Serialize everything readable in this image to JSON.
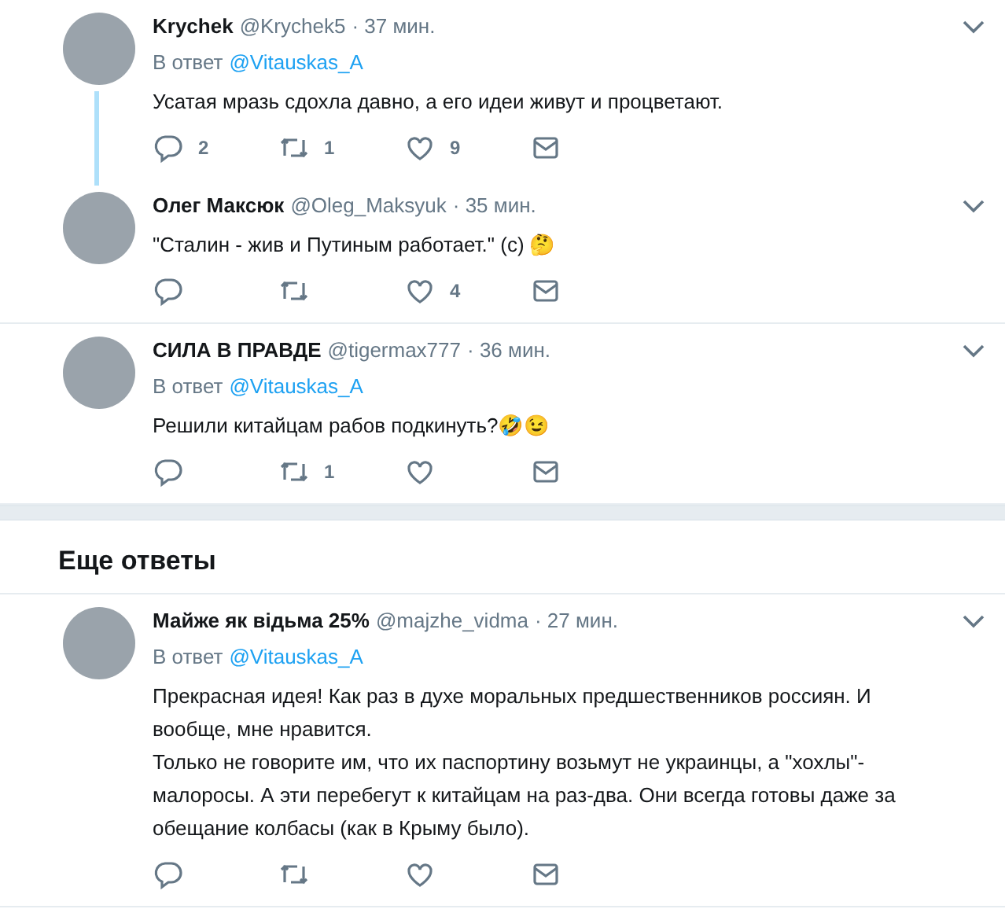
{
  "groups": [
    {
      "tweets": [
        {
          "name": "Krychek",
          "handle": "@Krychek5",
          "time": "· 37 мин.",
          "reply_label": "В ответ",
          "reply_to": "@Vitauskas_A",
          "threaded_below": true,
          "paragraphs": [
            "Усатая мразь сдохла давно, а его идеи живут и процветают."
          ],
          "actions": [
            {
              "kind": "reply",
              "count": "2"
            },
            {
              "kind": "retweet",
              "count": "1"
            },
            {
              "kind": "like",
              "count": "9"
            },
            {
              "kind": "message"
            }
          ]
        },
        {
          "name": "Олег Максюк",
          "handle": "@Oleg_Maksyuk",
          "time": "· 35 мин.",
          "threaded_below": false,
          "paragraphs": [
            "\"Сталин - жив и Путиным работает.\" (с) 🤔"
          ],
          "actions": [
            {
              "kind": "reply"
            },
            {
              "kind": "retweet"
            },
            {
              "kind": "like",
              "count": "4"
            },
            {
              "kind": "message"
            }
          ]
        },
        {
          "name": "СИЛА В ПРАВДЕ",
          "handle": "@tigermax777",
          "time": "· 36 мин.",
          "reply_label": "В ответ",
          "reply_to": "@Vitauskas_A",
          "threaded_below": false,
          "paragraphs": [
            "Решили китайцам рабов подкинуть?🤣😉"
          ],
          "actions": [
            {
              "kind": "reply"
            },
            {
              "kind": "retweet",
              "count": "1"
            },
            {
              "kind": "like"
            },
            {
              "kind": "message"
            }
          ]
        }
      ]
    },
    {
      "heading": "Еще ответы",
      "tweets": [
        {
          "name": "Майже як відьма 25%",
          "handle": "@majzhe_vidma",
          "time": "· 27 мин.",
          "reply_label": "В ответ",
          "reply_to": "@Vitauskas_A",
          "threaded_below": false,
          "paragraphs": [
            "Прекрасная идея! Как раз в духе моральных предшественников россиян. И вообще, мне нравится.",
            "Только не говорите им, что их паспортину возьмут не украинцы, а \"хохлы\"-малоросы. А эти перебегут к китайцам на раз-два. Они всегда готовы даже за обещание колбасы (как в Крыму было)."
          ],
          "actions": [
            {
              "kind": "reply"
            },
            {
              "kind": "retweet"
            },
            {
              "kind": "like"
            },
            {
              "kind": "message"
            }
          ]
        }
      ]
    }
  ]
}
